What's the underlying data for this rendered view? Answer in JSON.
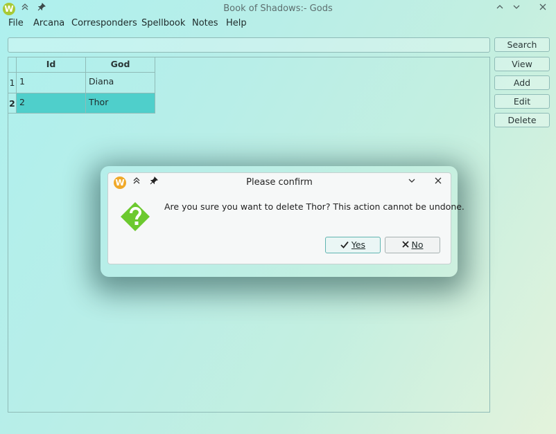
{
  "window": {
    "title": "Book of Shadows:- Gods",
    "logo_letter": "W",
    "icons": [
      "keep-above-icon",
      "pin-icon",
      "minimize-icon",
      "maximize-icon",
      "close-icon"
    ]
  },
  "menu": [
    "File",
    "Arcana",
    "Corresponders",
    "Spellbook",
    "Notes",
    "Help"
  ],
  "search": {
    "value": "",
    "placeholder": ""
  },
  "side_buttons": [
    "Search",
    "View",
    "Add",
    "Edit",
    "Delete"
  ],
  "table": {
    "columns": [
      "Id",
      "God"
    ],
    "rows": [
      {
        "num": "1",
        "id": "1",
        "god": "Diana",
        "selected": false
      },
      {
        "num": "2",
        "id": "2",
        "god": "Thor",
        "selected": true
      }
    ]
  },
  "dialog": {
    "title": "Please confirm",
    "logo_letter": "W",
    "message": "Are you sure you want to delete Thor? This action cannot be undone.",
    "yes_label": "Yes",
    "no_label": "No",
    "icon": "question-icon"
  },
  "colors": {
    "selection": "#4fcfcb",
    "question_icon": "#6cc92f",
    "border": "#8fbbb7"
  }
}
